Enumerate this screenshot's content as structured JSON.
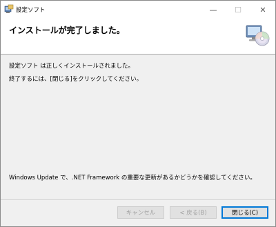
{
  "window": {
    "title": "設定ソフト",
    "minimize_glyph": "—",
    "maximize_glyph": "☐",
    "close_glyph": "✕"
  },
  "header": {
    "title": "インストールが完了しました。",
    "graphic_icon": "installer-disc-computer-icon"
  },
  "body": {
    "line1": "設定ソフト は正しくインストールされました。",
    "line2": "終了するには、[閉じる]をクリックしてください。",
    "line3": "Windows Update で、.NET Framework の重要な更新があるかどうかを確認してください。"
  },
  "buttons": {
    "cancel": "キャンセル",
    "back": "< 戻る(B)",
    "close": "閉じる(C)"
  },
  "colors": {
    "focus_border": "#0078d7",
    "disabled_text": "#a0a0a0"
  }
}
